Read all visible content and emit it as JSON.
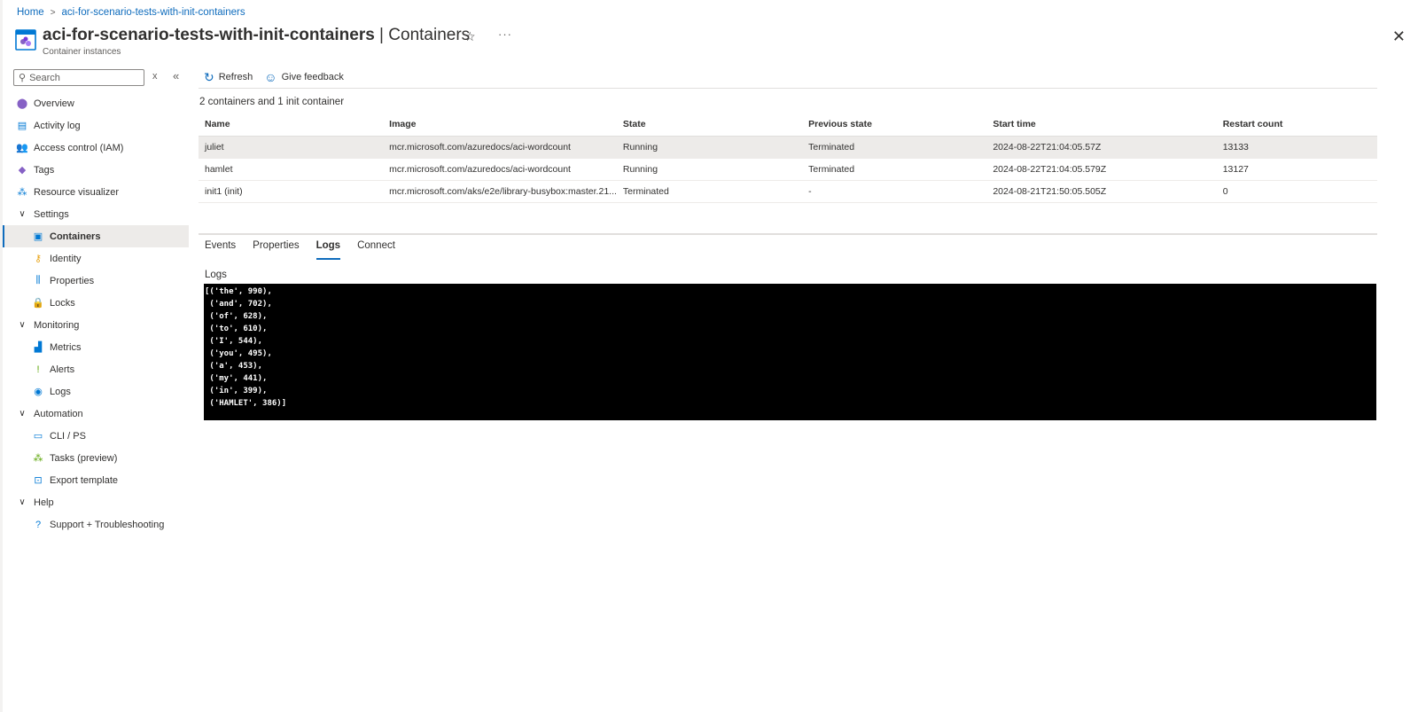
{
  "breadcrumb": {
    "home": "Home",
    "resource": "aci-for-scenario-tests-with-init-containers"
  },
  "header": {
    "resource_name": "aci-for-scenario-tests-with-init-containers",
    "separator": " | ",
    "page_title": "Containers",
    "subtitle": "Container instances",
    "star_icon": "☆",
    "more_icon": "···",
    "close_icon": "✕"
  },
  "sidebar": {
    "search_placeholder": "Search",
    "clear_icon": "x",
    "collapse_icon": "«",
    "items": [
      {
        "label": "Overview",
        "icon": "overview-icon",
        "glyph": "⬤",
        "color": "#8661c5",
        "level": 0
      },
      {
        "label": "Activity log",
        "icon": "activity-log-icon",
        "glyph": "▤",
        "color": "#0078d4",
        "level": 0
      },
      {
        "label": "Access control (IAM)",
        "icon": "iam-icon",
        "glyph": "👥",
        "color": "#0078d4",
        "level": 0
      },
      {
        "label": "Tags",
        "icon": "tag-icon",
        "glyph": "◆",
        "color": "#8661c5",
        "level": 0
      },
      {
        "label": "Resource visualizer",
        "icon": "visualizer-icon",
        "glyph": "⁂",
        "color": "#0078d4",
        "level": 0
      },
      {
        "label": "Settings",
        "icon": "chevron-down-icon",
        "glyph": "∨",
        "group": true,
        "level": 0
      },
      {
        "label": "Containers",
        "icon": "containers-icon",
        "glyph": "▣",
        "color": "#0078d4",
        "level": 1,
        "selected": true
      },
      {
        "label": "Identity",
        "icon": "identity-icon",
        "glyph": "⚷",
        "color": "#e8a317",
        "level": 1
      },
      {
        "label": "Properties",
        "icon": "properties-icon",
        "glyph": "⫼",
        "color": "#0078d4",
        "level": 1
      },
      {
        "label": "Locks",
        "icon": "lock-icon",
        "glyph": "🔒",
        "color": "#0078d4",
        "level": 1
      },
      {
        "label": "Monitoring",
        "icon": "chevron-down-icon",
        "glyph": "∨",
        "group": true,
        "level": 0
      },
      {
        "label": "Metrics",
        "icon": "metrics-icon",
        "glyph": "▟",
        "color": "#0078d4",
        "level": 1
      },
      {
        "label": "Alerts",
        "icon": "alert-icon",
        "glyph": "!",
        "color": "#57a300",
        "level": 1
      },
      {
        "label": "Logs",
        "icon": "logs-icon",
        "glyph": "◉",
        "color": "#0078d4",
        "level": 1
      },
      {
        "label": "Automation",
        "icon": "chevron-down-icon",
        "glyph": "∨",
        "group": true,
        "level": 0
      },
      {
        "label": "CLI / PS",
        "icon": "cli-icon",
        "glyph": "▭",
        "color": "#0078d4",
        "level": 1
      },
      {
        "label": "Tasks (preview)",
        "icon": "tasks-icon",
        "glyph": "⁂",
        "color": "#57a300",
        "level": 1
      },
      {
        "label": "Export template",
        "icon": "export-template-icon",
        "glyph": "⊡",
        "color": "#0078d4",
        "level": 1
      },
      {
        "label": "Help",
        "icon": "chevron-down-icon",
        "glyph": "∨",
        "group": true,
        "level": 0
      },
      {
        "label": "Support + Troubleshooting",
        "icon": "help-icon",
        "glyph": "?",
        "color": "#0078d4",
        "level": 1
      }
    ]
  },
  "toolbar": {
    "refresh": "Refresh",
    "feedback": "Give feedback"
  },
  "containers": {
    "count_text": "2 containers and 1 init container",
    "columns": [
      "Name",
      "Image",
      "State",
      "Previous state",
      "Start time",
      "Restart count"
    ],
    "rows": [
      [
        "juliet",
        "mcr.microsoft.com/azuredocs/aci-wordcount",
        "Running",
        "Terminated",
        "2024-08-22T21:04:05.57Z",
        "13133"
      ],
      [
        "hamlet",
        "mcr.microsoft.com/azuredocs/aci-wordcount",
        "Running",
        "Terminated",
        "2024-08-22T21:04:05.579Z",
        "13127"
      ],
      [
        "init1 (init)",
        "mcr.microsoft.com/aks/e2e/library-busybox:master.21...",
        "Terminated",
        "-",
        "2024-08-21T21:50:05.505Z",
        "0"
      ]
    ],
    "selected_row": 0
  },
  "tabs": {
    "items": [
      "Events",
      "Properties",
      "Logs",
      "Connect"
    ],
    "active": 2
  },
  "logs": {
    "label": "Logs",
    "lines": [
      "[('the', 990),",
      " ('and', 702),",
      " ('of', 628),",
      " ('to', 610),",
      " ('I', 544),",
      " ('you', 495),",
      " ('a', 453),",
      " ('my', 441),",
      " ('in', 399),",
      " ('HAMLET', 386)]"
    ]
  },
  "colors": {
    "accent": "#0f6cbd",
    "console_bg": "#000000",
    "selected_bg": "#edebe9"
  }
}
